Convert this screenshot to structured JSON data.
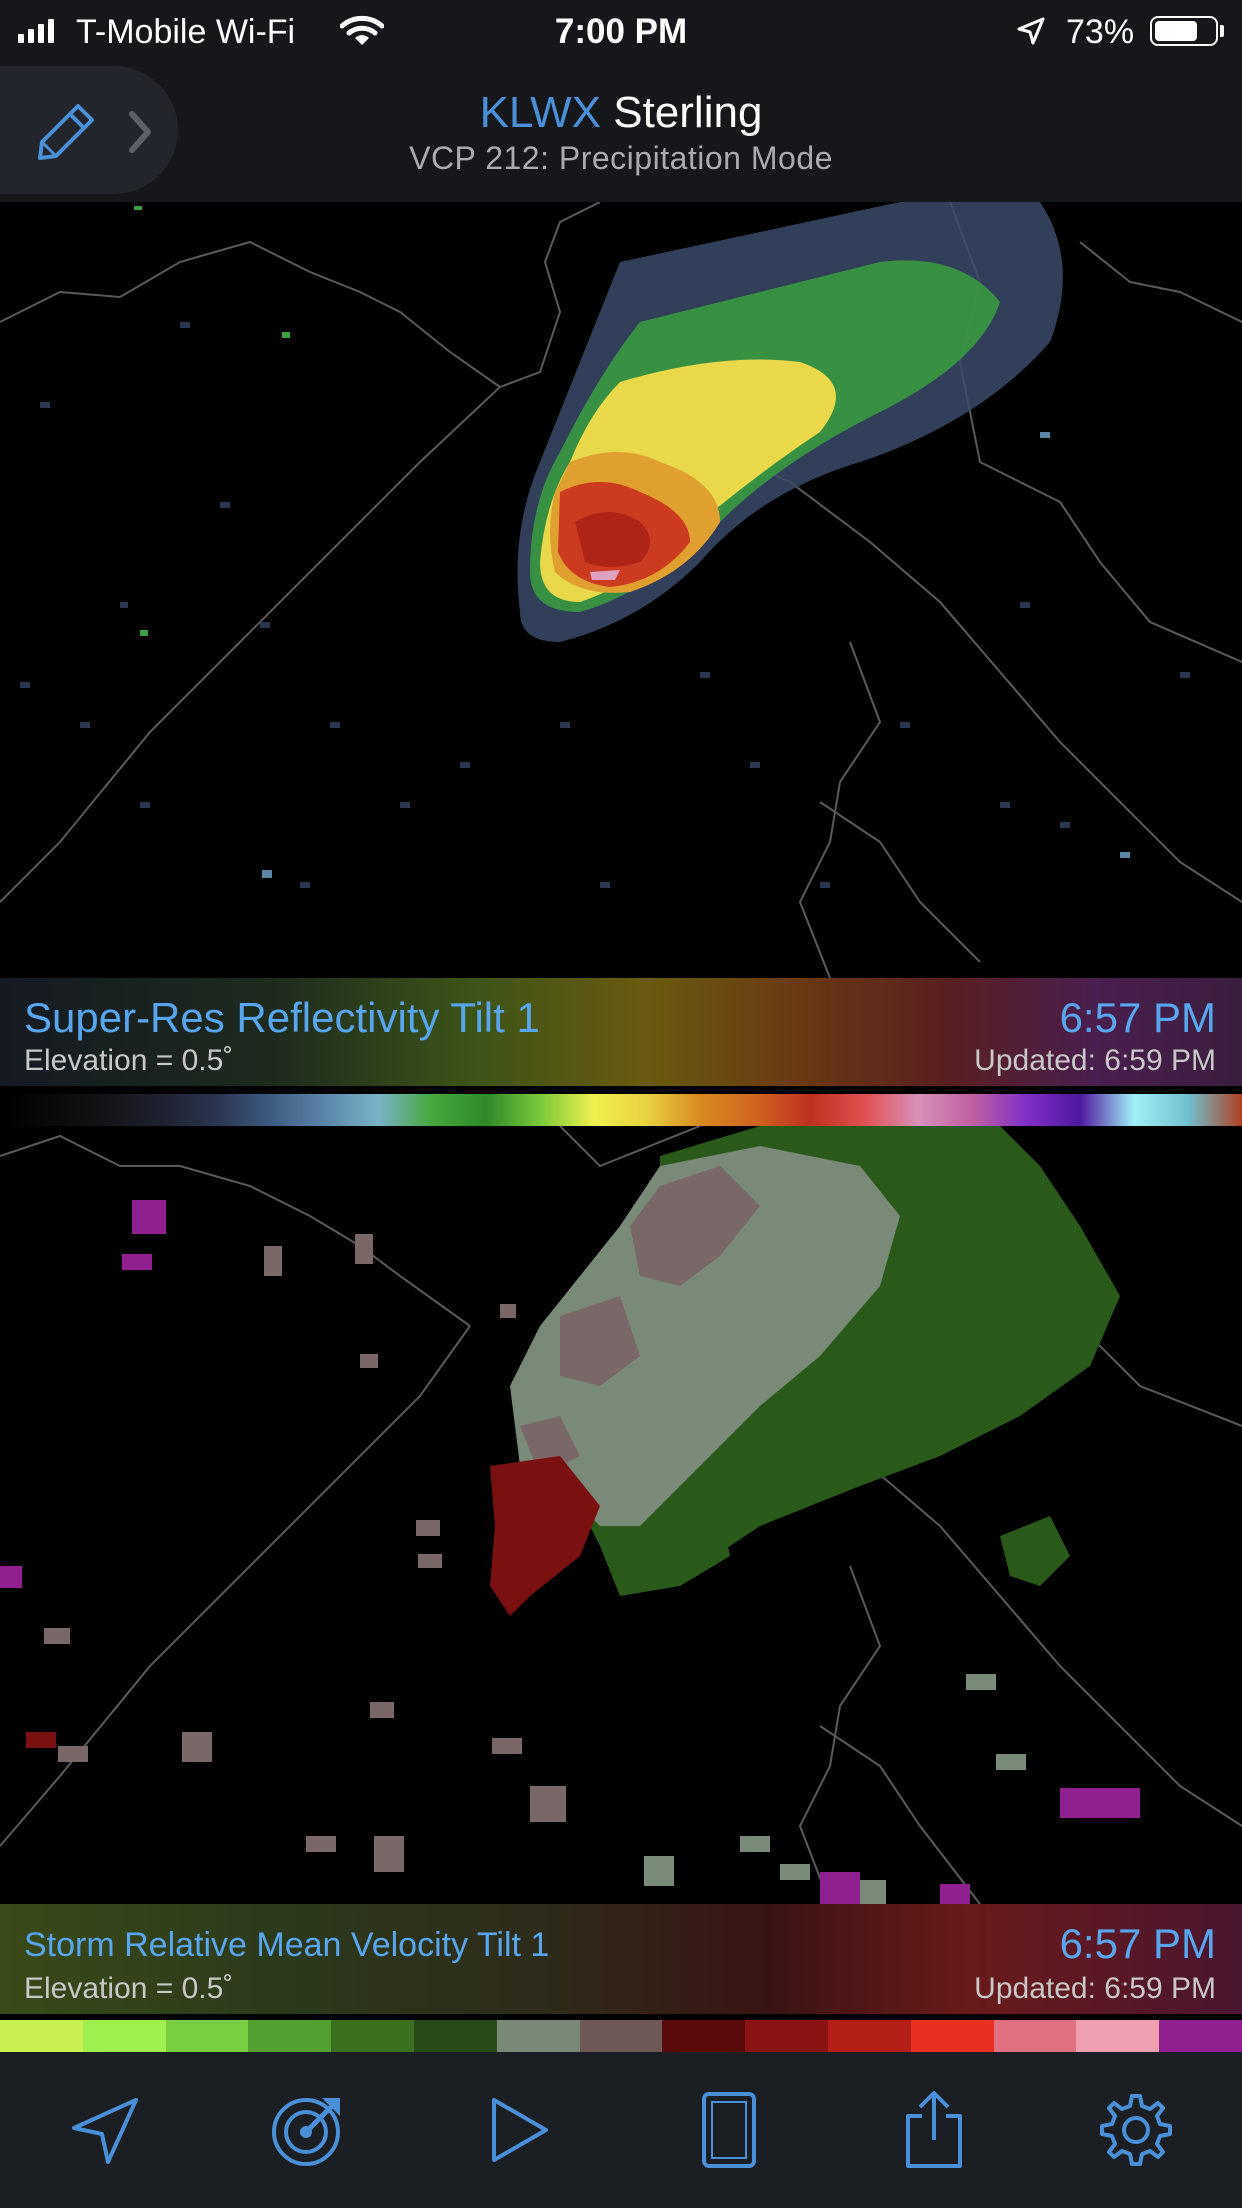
{
  "status_bar": {
    "carrier": "T-Mobile Wi-Fi",
    "time": "7:00 PM",
    "battery_percent_label": "73%",
    "battery_level": 0.73,
    "icons": [
      "signal-icon",
      "wifi-icon",
      "location-arrow-icon",
      "battery-icon"
    ]
  },
  "header": {
    "station_code": "KLWX",
    "station_name": "Sterling",
    "vcp_mode": "VCP 212: Precipitation Mode",
    "edit_icon": "pencil-icon",
    "expand_icon": "chevron-right-icon"
  },
  "reflectivity_panel": {
    "product": "Super-Res Reflectivity Tilt 1",
    "elevation": "Elevation = 0.5˚",
    "scan_time": "6:57 PM",
    "updated": "Updated: 6:59 PM",
    "color_scale": [
      "#000000",
      "#0a0a0a",
      "#141418",
      "#1e2230",
      "#2a3550",
      "#3d5a80",
      "#5a85a8",
      "#7ab2c8",
      "#45a83c",
      "#2e8a2a",
      "#7ac83a",
      "#f0f050",
      "#e8d040",
      "#d88820",
      "#d06420",
      "#c03020",
      "#e05050",
      "#d890b8",
      "#c060a0",
      "#8030c8",
      "#5018a0",
      "#a0f0f8",
      "#70c0d0",
      "#b04020"
    ]
  },
  "velocity_panel": {
    "product": "Storm Relative Mean Velocity Tilt 1",
    "elevation": "Elevation = 0.5˚",
    "scan_time": "6:57 PM",
    "updated": "Updated: 6:59 PM",
    "color_scale": [
      "#c8f050",
      "#a0f050",
      "#78d040",
      "#54a030",
      "#3a7020",
      "#284a18",
      "#7a8878",
      "#6e5858",
      "#5a0a0a",
      "#8a1414",
      "#b42018",
      "#e83020",
      "#e07080",
      "#f0a0b0",
      "#902090"
    ]
  },
  "toolbar": {
    "buttons": [
      {
        "name": "location-button",
        "icon": "location-arrow-icon"
      },
      {
        "name": "radar-select-button",
        "icon": "radar-target-icon"
      },
      {
        "name": "play-button",
        "icon": "play-icon"
      },
      {
        "name": "layout-button",
        "icon": "panel-layout-icon"
      },
      {
        "name": "share-button",
        "icon": "share-icon"
      },
      {
        "name": "settings-button",
        "icon": "gear-icon"
      }
    ]
  },
  "colors": {
    "accent": "#4a90d9",
    "header_bg": "#15171b",
    "toolbar_bg": "#1b1e23"
  }
}
